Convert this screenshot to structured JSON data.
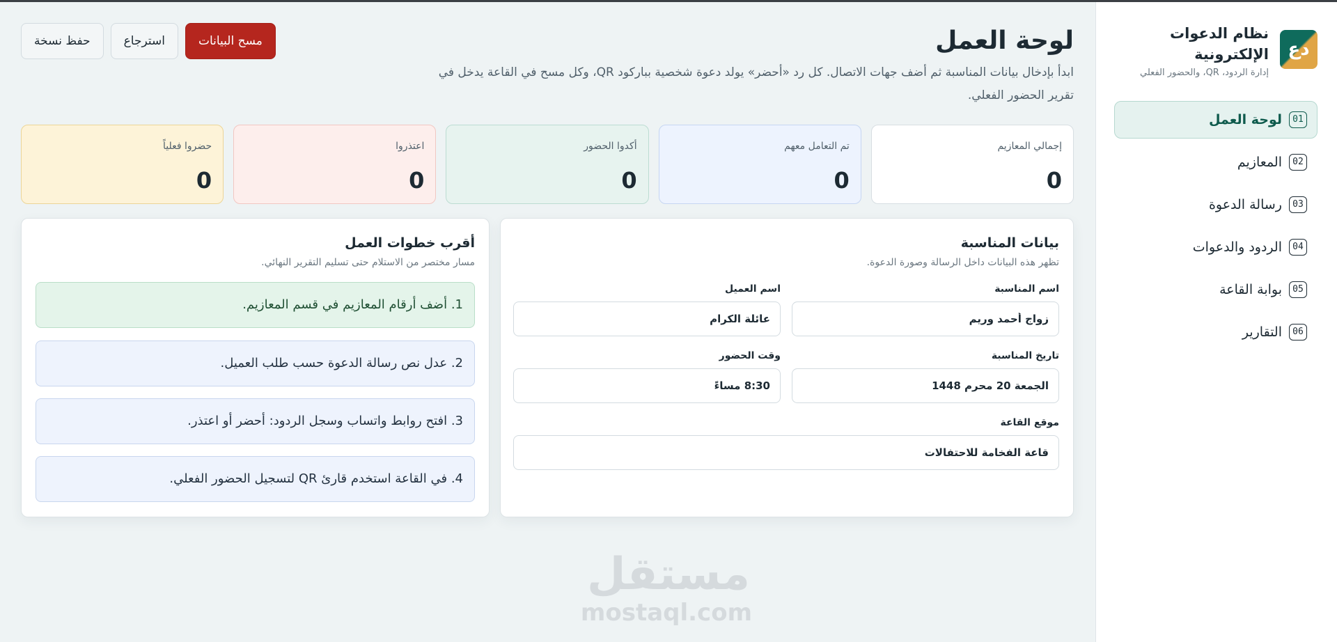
{
  "sidebar": {
    "brand_logo": "دع",
    "brand_title": "نظام الدعوات الإلكترونية",
    "brand_subtitle": "إدارة الردود، QR، والحضور الفعلي",
    "items": [
      {
        "num": "01",
        "label": "لوحة العمل"
      },
      {
        "num": "02",
        "label": "المعازيم"
      },
      {
        "num": "03",
        "label": "رسالة الدعوة"
      },
      {
        "num": "04",
        "label": "الردود والدعوات"
      },
      {
        "num": "05",
        "label": "بوابة القاعة"
      },
      {
        "num": "06",
        "label": "التقارير"
      }
    ]
  },
  "header": {
    "title": "لوحة العمل",
    "description": "ابدأ بإدخال بيانات المناسبة ثم أضف جهات الاتصال. كل رد «أحضر» يولد دعوة شخصية بباركود QR، وكل مسح في القاعة يدخل في تقرير الحضور الفعلي.",
    "actions": {
      "save": "حفظ نسخة",
      "restore": "استرجاع",
      "clear": "مسح البيانات"
    }
  },
  "stats": [
    {
      "label": "إجمالي المعازيم",
      "value": "0"
    },
    {
      "label": "تم التعامل معهم",
      "value": "0"
    },
    {
      "label": "أكدوا الحضور",
      "value": "0"
    },
    {
      "label": "اعتذروا",
      "value": "0"
    },
    {
      "label": "حضروا فعلياً",
      "value": "0"
    }
  ],
  "event_panel": {
    "title": "بيانات المناسبة",
    "subtitle": "تظهر هذه البيانات داخل الرسالة وصورة الدعوة.",
    "fields": {
      "event_name": {
        "label": "اسم المناسبة",
        "value": "زواج أحمد وريم"
      },
      "client_name": {
        "label": "اسم العميل",
        "value": "عائلة الكرام"
      },
      "event_date": {
        "label": "تاريخ المناسبة",
        "value": "الجمعة 20 محرم 1448"
      },
      "attend_time": {
        "label": "وقت الحضور",
        "value": "8:30 مساءً"
      },
      "venue": {
        "label": "موقع القاعة",
        "value": "قاعة الفخامة للاحتفالات"
      }
    }
  },
  "steps_panel": {
    "title": "أقرب خطوات العمل",
    "subtitle": "مسار مختصر من الاستلام حتى تسليم التقرير النهائي.",
    "steps": [
      "1. أضف أرقام المعازيم في قسم المعازيم.",
      "2. عدل نص رسالة الدعوة حسب طلب العميل.",
      "3. افتح روابط واتساب وسجل الردود: أحضر أو اعتذر.",
      "4. في القاعة استخدم قارئ QR لتسجيل الحضور الفعلي."
    ]
  },
  "watermark": {
    "main": "مستقل",
    "sub": "mostaql.com"
  }
}
